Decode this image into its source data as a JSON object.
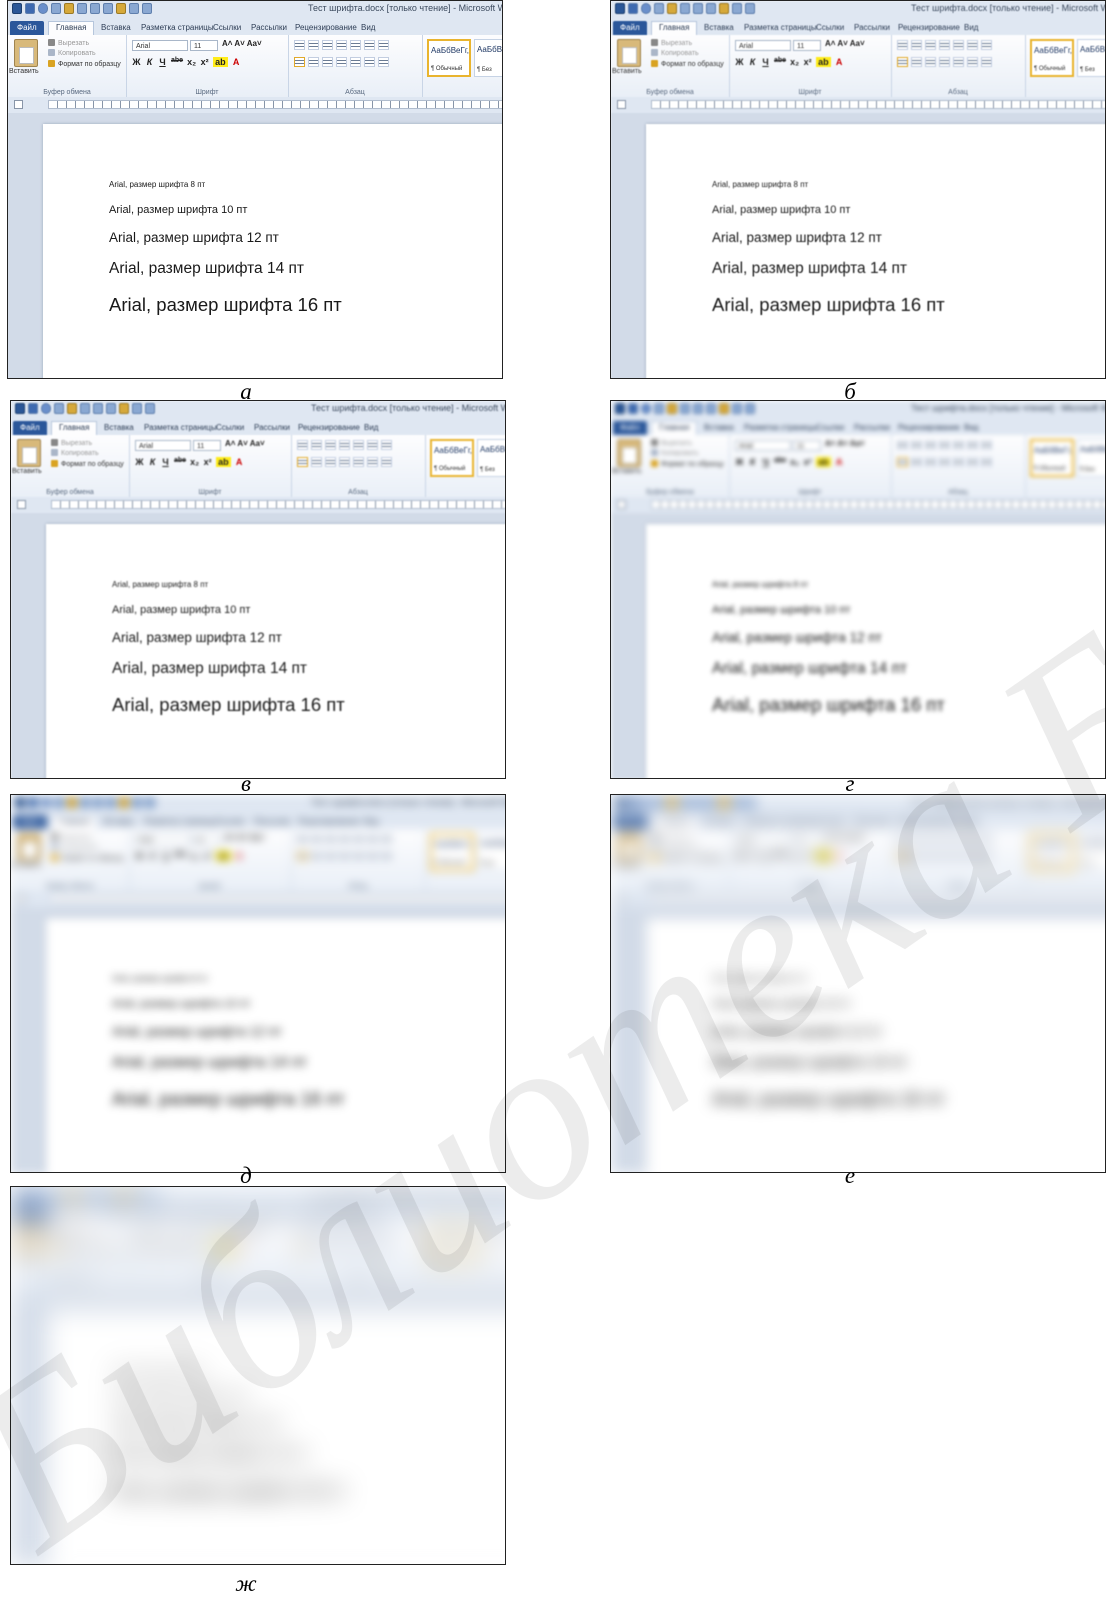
{
  "screenshot": {
    "window_title": "Тест шрифта.docx [только чтение] - Microsoft Word",
    "tabs": [
      "Файл",
      "Главная",
      "Вставка",
      "Разметка страницы",
      "Ссылки",
      "Рассылки",
      "Рецензирование",
      "Вид"
    ],
    "active_tab": "Главная",
    "clipboard": {
      "paste": "Вставить",
      "cut": "Вырезать",
      "copy": "Копировать",
      "format_painter": "Формат по образцу",
      "group": "Буфер обмена"
    },
    "font": {
      "name": "Arial",
      "size": "11",
      "group": "Шрифт",
      "grow": "A˄",
      "shrink": "A˅",
      "case": "Aa˅",
      "bold": "Ж",
      "italic": "К",
      "underline": "Ч",
      "strike": "abe",
      "sub": "x₂",
      "sup": "x²"
    },
    "paragraph": {
      "group": "Абзац"
    },
    "styles": {
      "sample": "АаБбВеГг,",
      "normal": "¶ Обычный",
      "second": "¶ Без"
    },
    "document_lines": [
      "Arial, размер шрифта 8 пт",
      "Arial, размер шрифта 10 пт",
      "Arial, размер шрифта 12 пт",
      "Arial, размер шрифта 14 пт",
      "Arial, размер шрифта 16 пт"
    ]
  },
  "panels": [
    {
      "caption": "а",
      "blur": 0
    },
    {
      "caption": "б",
      "blur": 0.45
    },
    {
      "caption": "в",
      "blur": 0.9
    },
    {
      "caption": "г",
      "blur": 2.2
    },
    {
      "caption": "д",
      "blur": 4.5
    },
    {
      "caption": "е",
      "blur": 7
    },
    {
      "caption": "ж",
      "blur": 13
    }
  ],
  "watermark": "Библиотека БГУИР"
}
